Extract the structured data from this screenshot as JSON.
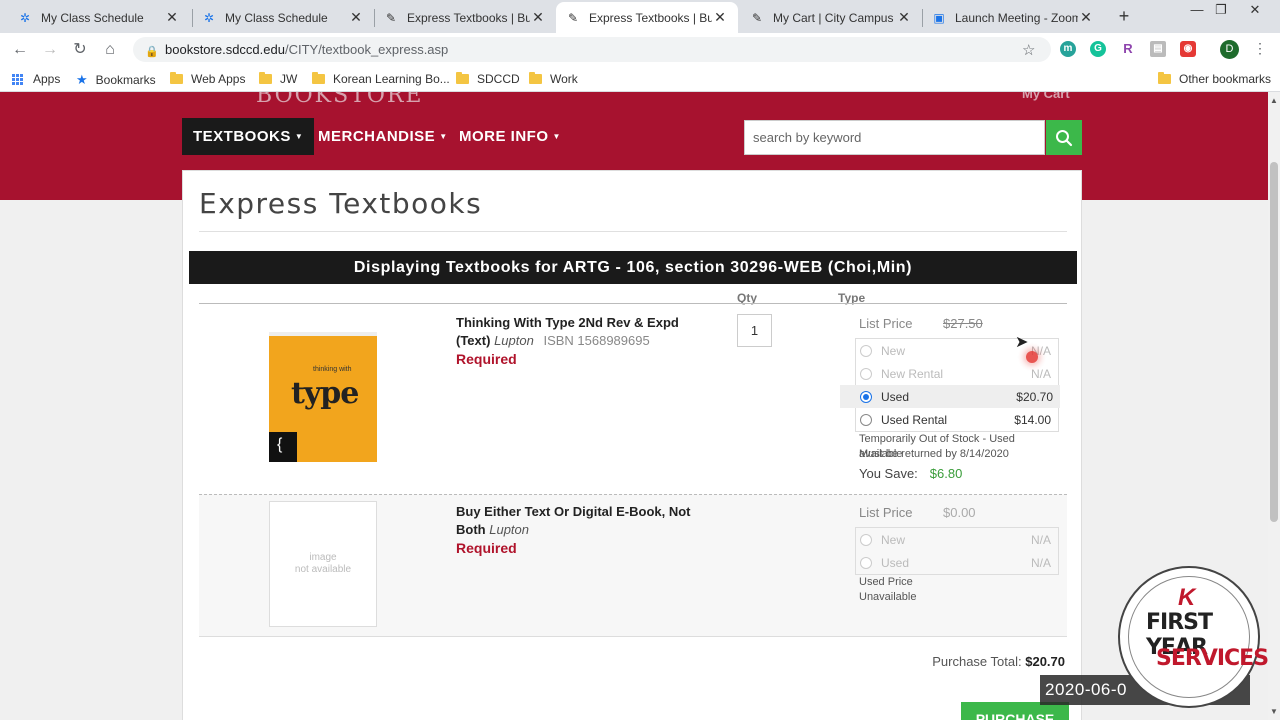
{
  "browser": {
    "tabs": [
      {
        "title": "My Class Schedule"
      },
      {
        "title": "My Class Schedule"
      },
      {
        "title": "Express Textbooks | Buy"
      },
      {
        "title": "Express Textbooks | Buy"
      },
      {
        "title": "My Cart | City Campus E"
      },
      {
        "title": "Launch Meeting - Zoom"
      }
    ],
    "url_host": "bookstore.sdccd.edu",
    "url_path": "/CITY/textbook_express.asp",
    "avatar_letter": "D",
    "bookmarks": [
      "Apps",
      "Bookmarks",
      "Web Apps",
      "JW",
      "Korean Learning Bo...",
      "SDCCD",
      "Work"
    ],
    "other_bookmarks": "Other bookmarks"
  },
  "site": {
    "brand": "BOOKSTORE",
    "cart_peek": "My Cart",
    "nav": [
      "TEXTBOOKS",
      "MERCHANDISE",
      "MORE INFO"
    ],
    "search_placeholder": "search by keyword"
  },
  "main": {
    "title": "Express Textbooks",
    "course_banner": "Displaying Textbooks for ARTG - 106, section 30296-WEB (Choi,Min)",
    "col_qty": "Qty",
    "col_type": "Type",
    "books": [
      {
        "title": "Thinking With Type 2Nd Rev & Expd (Text)",
        "author": "Lupton",
        "isbn": "ISBN 1568989695",
        "required": "Required",
        "qty": "1",
        "list_price_label": "List Price",
        "list_price": "$27.50",
        "options": [
          {
            "label": "New",
            "price": "N/A"
          },
          {
            "label": "New Rental",
            "price": "N/A"
          },
          {
            "label": "Used",
            "price": "$20.70"
          },
          {
            "label": "Used Rental",
            "price": "$14.00"
          }
        ],
        "note_1": "Temporarily Out of Stock - Used available",
        "note_2": "Must be returned by 8/14/2020",
        "you_save_label": "You Save:",
        "you_save": "$6.80",
        "cover_word": "type",
        "cover_top": "thinking with"
      },
      {
        "title": "Buy Either Text Or Digital E-Book, Not Both",
        "author": "Lupton",
        "required": "Required",
        "list_price_label": "List Price",
        "list_price": "$0.00",
        "options": [
          {
            "label": "New",
            "price": "N/A"
          },
          {
            "label": "Used",
            "price": "N/A"
          }
        ],
        "note_1": "Used Price",
        "note_2": "Unavailable",
        "no_image_1": "image",
        "no_image_2": "not available"
      }
    ],
    "purchase_total_label": "Purchase Total:",
    "purchase_total": "$20.70",
    "purchase_button": "PURCHASE"
  },
  "overlay": {
    "badge_line1": "FIRST YEAR",
    "badge_line2": "SERVICES",
    "timestamp": "2020-06-0"
  },
  "colors": {
    "brand_red": "#a7122f",
    "accent_green": "#3cb84a"
  }
}
